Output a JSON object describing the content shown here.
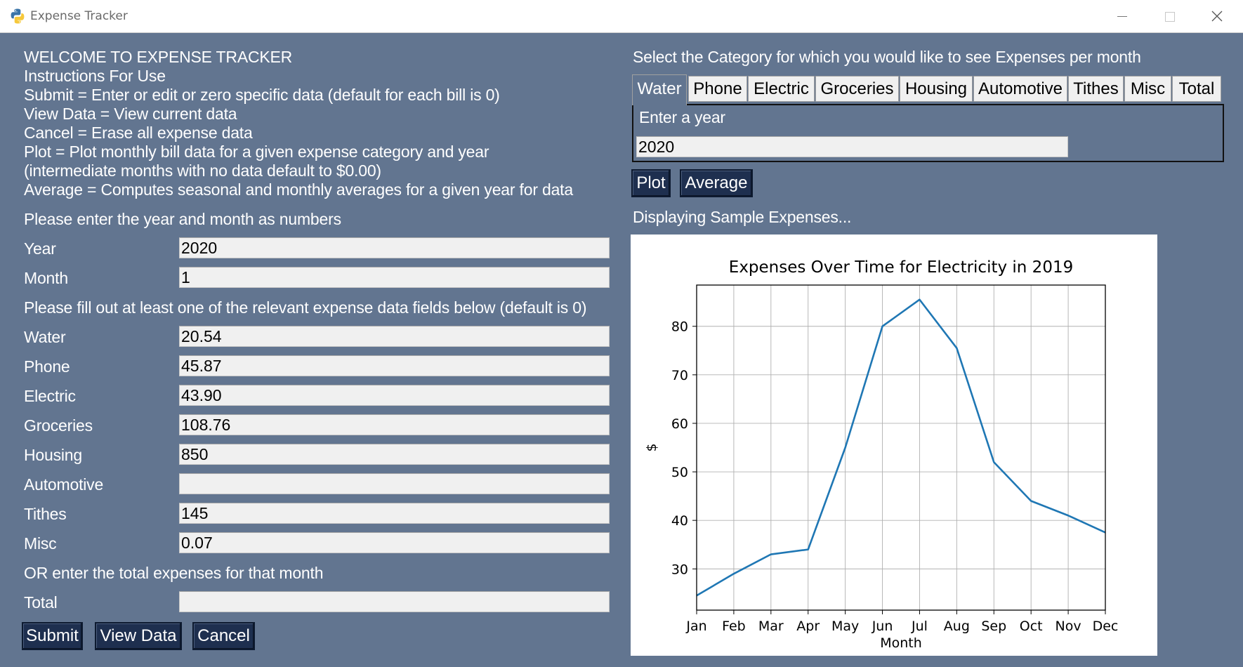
{
  "window": {
    "title": "Expense Tracker",
    "icon": "python-icon",
    "controls": [
      "minimize-icon",
      "maximize-icon",
      "close-icon"
    ]
  },
  "instructions": [
    "WELCOME TO EXPENSE TRACKER",
    "Instructions For Use",
    "Submit = Enter or edit or zero specific data (default for each bill is 0)",
    "View Data = View current data",
    "Cancel = Erase all expense data",
    "Plot = Plot monthly bill data for a given expense category and year",
    "(intermediate months with no data default to $0.00)",
    "Average = Computes seasonal and monthly averages for a given year for data"
  ],
  "form": {
    "year_month_prompt": "Please enter the year and month as numbers",
    "year_label": "Year",
    "year_value": "2020",
    "month_label": "Month",
    "month_value": "1",
    "expense_prompt": "Please fill out at least one of the relevant expense data fields below (default is 0)",
    "expenses": [
      {
        "label": "Water",
        "value": "20.54"
      },
      {
        "label": "Phone",
        "value": "45.87"
      },
      {
        "label": "Electric",
        "value": "43.90"
      },
      {
        "label": "Groceries",
        "value": "108.76"
      },
      {
        "label": "Housing",
        "value": "850"
      },
      {
        "label": "Automotive",
        "value": ""
      },
      {
        "label": "Tithes",
        "value": "145"
      },
      {
        "label": "Misc",
        "value": "0.07"
      }
    ],
    "total_prompt": "OR enter the total expenses for that month",
    "total_label": "Total",
    "total_value": "",
    "submit_label": "Submit",
    "view_label": "View Data",
    "cancel_label": "Cancel"
  },
  "plot_panel": {
    "category_prompt": "Select the Category for which you would like to see Expenses per month",
    "tabs": [
      "Water",
      "Phone",
      "Electric",
      "Groceries",
      "Housing",
      "Automotive",
      "Tithes",
      "Misc",
      "Total"
    ],
    "active_tab": "Water",
    "year_prompt": "Enter a year",
    "year_value": "2020",
    "plot_label": "Plot",
    "average_label": "Average",
    "status": "Displaying Sample Expenses..."
  },
  "colors": {
    "background": "#627590",
    "button": "#1e2f4f",
    "line": "#1f77b4"
  },
  "chart_data": {
    "type": "line",
    "title": "Expenses Over Time for Electricity in 2019",
    "xlabel": "Month",
    "ylabel": "$",
    "categories": [
      "Jan",
      "Feb",
      "Mar",
      "Apr",
      "May",
      "Jun",
      "Jul",
      "Aug",
      "Sep",
      "Oct",
      "Nov",
      "Dec"
    ],
    "values": [
      24.5,
      29,
      33,
      34,
      55,
      80,
      85.5,
      75.5,
      52,
      44,
      41,
      37.5
    ],
    "yticks": [
      30,
      40,
      50,
      60,
      70,
      80
    ],
    "ylim": [
      21.5,
      88.5
    ],
    "grid": true
  }
}
